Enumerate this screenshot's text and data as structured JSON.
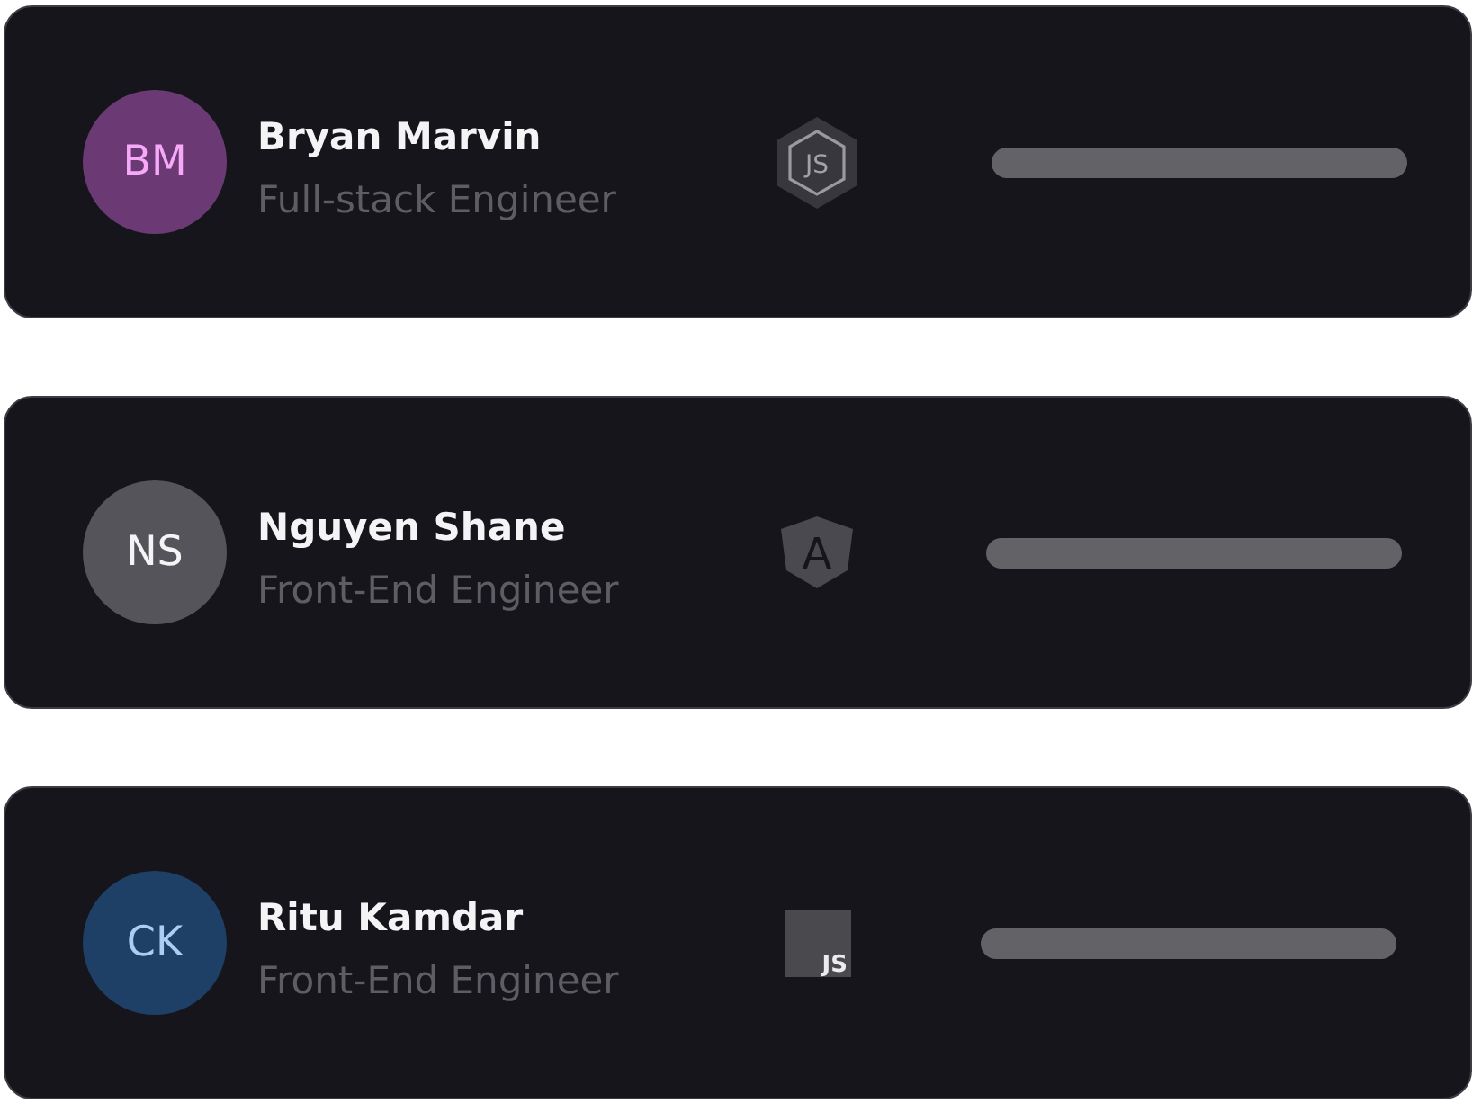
{
  "members": [
    {
      "name": "Bryan Marvin",
      "role": "Full-stack Engineer",
      "avatar": {
        "color": "#6b3a74",
        "initials": {
          "text": "BM",
          "color": "#f5a9f8"
        }
      },
      "tech": {
        "kind": "nodejs",
        "label": "JS"
      }
    },
    {
      "name": "Nguyen Shane",
      "role": "Front-End Engineer",
      "avatar": {
        "color": "#55545a",
        "initials": {
          "text": "NS",
          "color": "#f4f4f6"
        }
      },
      "tech": {
        "kind": "angular",
        "label": "A"
      }
    },
    {
      "name": "Ritu Kamdar",
      "role": "Front-End Engineer",
      "avatar": {
        "color": "#1e3f66",
        "initials": {
          "text": "CK",
          "color": "#a9cdf5"
        }
      },
      "tech": {
        "kind": "js",
        "label": "JS"
      }
    }
  ]
}
